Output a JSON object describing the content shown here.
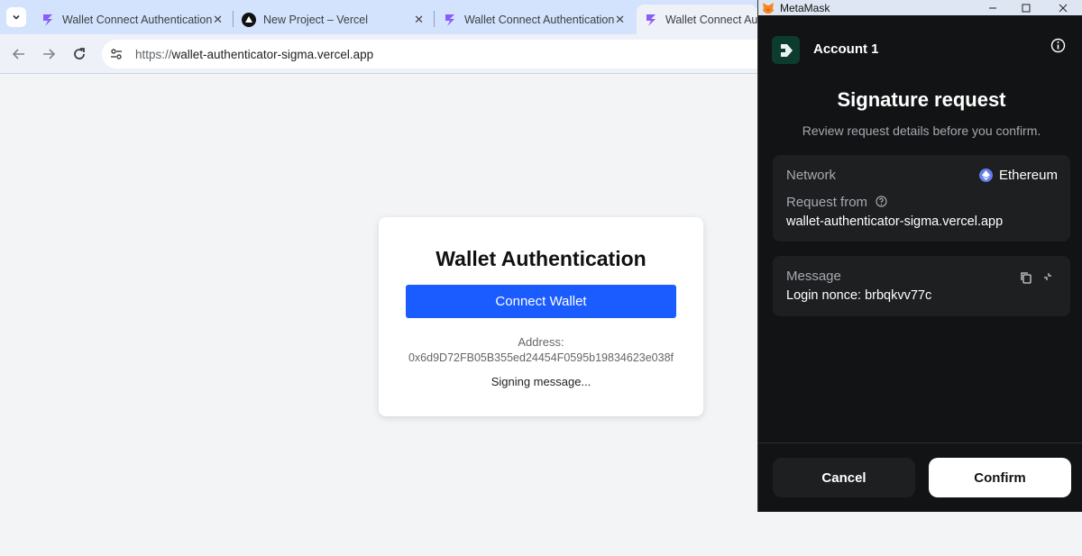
{
  "browser": {
    "tabs": [
      {
        "title": "Wallet Connect Authentication",
        "favicon": "purple-bolt-icon"
      },
      {
        "title": "New Project – Vercel",
        "favicon": "vercel-triangle-icon"
      },
      {
        "title": "Wallet Connect Authentication",
        "favicon": "purple-bolt-icon"
      },
      {
        "title": "Wallet Connect Authe",
        "favicon": "purple-bolt-icon"
      }
    ],
    "url_scheme": "https://",
    "url_host": "wallet-authenticator-sigma.vercel.app",
    "colors": {
      "tabstrip": "#d3e3fd",
      "active_tab": "#eef1f8"
    }
  },
  "page": {
    "title": "Wallet Authentication",
    "connect_button": "Connect Wallet",
    "address_label": "Address:",
    "address_value": "0x6d9D72FB05B355ed24454F0595b19834623e038f",
    "status": "Signing message...",
    "colors": {
      "button": "#1a5cff"
    }
  },
  "metamask": {
    "window_title": "MetaMask",
    "account_name": "Account 1",
    "title": "Signature request",
    "subtitle": "Review request details before you confirm.",
    "network_label": "Network",
    "network_value": "Ethereum",
    "request_from_label": "Request from",
    "request_from_value": "wallet-authenticator-sigma.vercel.app",
    "message_label": "Message",
    "message_value": "Login nonce: brbqkvv77c",
    "cancel_label": "Cancel",
    "confirm_label": "Confirm",
    "colors": {
      "background": "#121314",
      "panel": "#1e1f21",
      "ethereum": "#627eea"
    }
  }
}
